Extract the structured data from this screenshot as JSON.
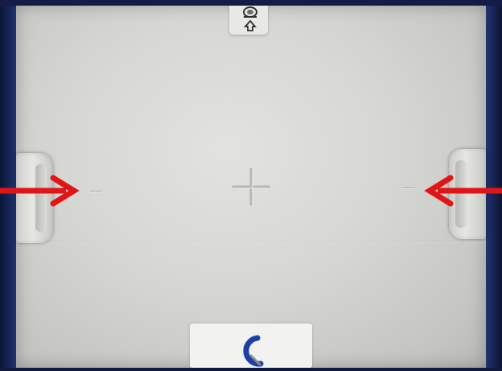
{
  "scene": {
    "subject": "white-plastic-device-back-panel",
    "colors": {
      "background": "#101a3c",
      "panel": "#d6d6d3",
      "arrow": "#e01515",
      "logo": "#1f3fa8"
    },
    "icons": [
      "tripod-mount-icon",
      "crosshair-icon",
      "logo-icon",
      "arrow-right-icon",
      "arrow-left-icon"
    ]
  }
}
